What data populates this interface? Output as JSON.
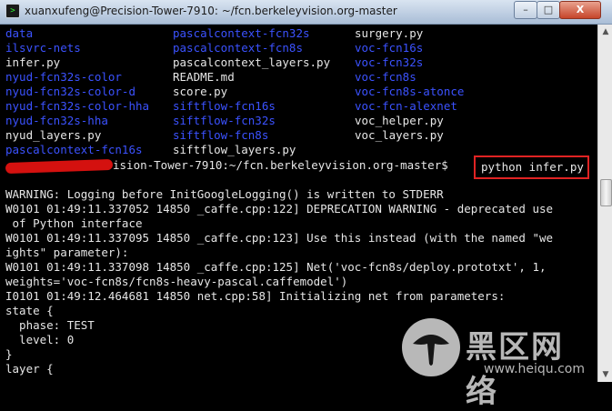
{
  "window": {
    "title": "xuanxufeng@Precision-Tower-7910: ~/fcn.berkeleyvision.org-master",
    "minimize_glyph": "–",
    "maximize_glyph": "□",
    "close_glyph": "X"
  },
  "ls_rows": [
    [
      {
        "text": "data",
        "kind": "dir"
      },
      {
        "text": "pascalcontext-fcn32s",
        "kind": "dir"
      },
      {
        "text": "surgery.py",
        "kind": "file"
      }
    ],
    [
      {
        "text": "ilsvrc-nets",
        "kind": "dir"
      },
      {
        "text": "pascalcontext-fcn8s",
        "kind": "dir"
      },
      {
        "text": "voc-fcn16s",
        "kind": "dir"
      }
    ],
    [
      {
        "text": "infer.py",
        "kind": "file"
      },
      {
        "text": "pascalcontext_layers.py",
        "kind": "file"
      },
      {
        "text": "voc-fcn32s",
        "kind": "dir"
      }
    ],
    [
      {
        "text": "nyud-fcn32s-color",
        "kind": "dir"
      },
      {
        "text": "README.md",
        "kind": "file"
      },
      {
        "text": "voc-fcn8s",
        "kind": "dir"
      }
    ],
    [
      {
        "text": "nyud-fcn32s-color-d",
        "kind": "dir"
      },
      {
        "text": "score.py",
        "kind": "file"
      },
      {
        "text": "voc-fcn8s-atonce",
        "kind": "dir"
      }
    ],
    [
      {
        "text": "nyud-fcn32s-color-hha",
        "kind": "dir"
      },
      {
        "text": "siftflow-fcn16s",
        "kind": "dir"
      },
      {
        "text": "voc-fcn-alexnet",
        "kind": "dir"
      }
    ],
    [
      {
        "text": "nyud-fcn32s-hha",
        "kind": "dir"
      },
      {
        "text": "siftflow-fcn32s",
        "kind": "dir"
      },
      {
        "text": "voc_helper.py",
        "kind": "file"
      }
    ],
    [
      {
        "text": "nyud_layers.py",
        "kind": "file"
      },
      {
        "text": "siftflow-fcn8s",
        "kind": "dir"
      },
      {
        "text": "voc_layers.py",
        "kind": "file"
      }
    ],
    [
      {
        "text": "pascalcontext-fcn16s",
        "kind": "dir"
      },
      {
        "text": "siftflow_layers.py",
        "kind": "file"
      },
      {
        "text": "",
        "kind": "file"
      }
    ]
  ],
  "prompt": "ision-Tower-7910:~/fcn.berkeleyvision.org-master$",
  "command": "python infer.py",
  "output_lines": [
    "WARNING: Logging before InitGoogleLogging() is written to STDERR",
    "W0101 01:49:11.337052 14850 _caffe.cpp:122] DEPRECATION WARNING - deprecated use",
    " of Python interface",
    "W0101 01:49:11.337095 14850 _caffe.cpp:123] Use this instead (with the named \"we",
    "ights\" parameter):",
    "W0101 01:49:11.337098 14850 _caffe.cpp:125] Net('voc-fcn8s/deploy.prototxt', 1,",
    "weights='voc-fcn8s/fcn8s-heavy-pascal.caffemodel')",
    "I0101 01:49:12.464681 14850 net.cpp:58] Initializing net from parameters:",
    "state {",
    "  phase: TEST",
    "  level: 0",
    "}",
    "layer {"
  ],
  "scrollbar": {
    "up_glyph": "▲",
    "down_glyph": "▼"
  },
  "watermark": {
    "chinese": "黑区网络",
    "url": "www.heiqu.com"
  },
  "colors": {
    "directory": "#3b52ff",
    "text": "#e6e6e6",
    "highlight_box": "#e02323",
    "redaction": "#d4110f"
  }
}
